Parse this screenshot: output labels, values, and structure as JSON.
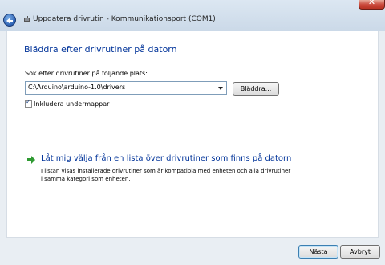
{
  "window": {
    "title": "Uppdatera drivrutin - Kommunikationsport (COM1)",
    "close_label": "✕"
  },
  "main": {
    "heading": "Bläddra efter drivrutiner på datorn",
    "search_label": "Sök efter drivrutiner på följande plats:",
    "path_value": "C:\\Arduino\\arduino-1.0\\drivers",
    "browse_label": "Bläddra...",
    "include_subfolders_label": "Inkludera undermappar",
    "include_subfolders_checked": true,
    "checkmark": "✓",
    "option": {
      "title": "Låt mig välja från en lista över drivrutiner som finns på datorn",
      "desc_line1": "I listan visas installerade drivrutiner som är kompatibla med enheten och alla drivrutiner",
      "desc_line2": "i samma kategori som enheten."
    }
  },
  "footer": {
    "next_label": "Nästa",
    "cancel_label": "Avbryt"
  },
  "icons": {
    "back": "back-arrow-icon",
    "title": "device-chip-icon",
    "option": "green-arrow-icon"
  },
  "colors": {
    "heading": "#003399",
    "link": "#003399",
    "close": "#c9473a",
    "arrow": "#2f9a32"
  }
}
